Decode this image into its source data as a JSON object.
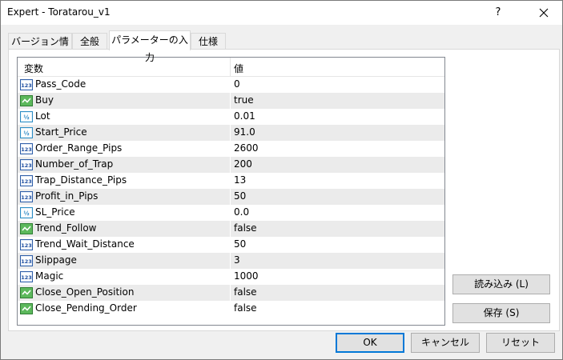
{
  "window": {
    "title": "Expert - Toratarou_v1",
    "help_label": "?"
  },
  "tabs": [
    {
      "label": "バージョン情報"
    },
    {
      "label": "全般"
    },
    {
      "label": "パラメーターの入力"
    },
    {
      "label": "仕様"
    }
  ],
  "grid": {
    "headers": {
      "variable": "変数",
      "value": "値"
    },
    "rows": [
      {
        "name": "Pass_Code",
        "value": "0",
        "icon": "int-icon"
      },
      {
        "name": "Buy",
        "value": "true",
        "icon": "bool-icon"
      },
      {
        "name": "Lot",
        "value": "0.01",
        "icon": "double-icon"
      },
      {
        "name": "Start_Price",
        "value": "91.0",
        "icon": "double-icon"
      },
      {
        "name": "Order_Range_Pips",
        "value": "2600",
        "icon": "int-icon"
      },
      {
        "name": "Number_of_Trap",
        "value": "200",
        "icon": "int-icon"
      },
      {
        "name": "Trap_Distance_Pips",
        "value": "13",
        "icon": "int-icon"
      },
      {
        "name": "Profit_in_Pips",
        "value": "50",
        "icon": "int-icon"
      },
      {
        "name": "SL_Price",
        "value": "0.0",
        "icon": "double-icon"
      },
      {
        "name": "Trend_Follow",
        "value": "false",
        "icon": "bool-icon"
      },
      {
        "name": "Trend_Wait_Distance",
        "value": "50",
        "icon": "int-icon"
      },
      {
        "name": "Slippage",
        "value": "3",
        "icon": "int-icon"
      },
      {
        "name": "Magic",
        "value": "1000",
        "icon": "int-icon"
      },
      {
        "name": "Close_Open_Position",
        "value": "false",
        "icon": "bool-icon"
      },
      {
        "name": "Close_Pending_Order",
        "value": "false",
        "icon": "bool-icon"
      }
    ]
  },
  "side_buttons": {
    "load": "読み込み (L)",
    "save": "保存 (S)"
  },
  "footer_buttons": {
    "ok": "OK",
    "cancel": "キャンセル",
    "reset": "リセット"
  },
  "colors": {
    "accent": "#0078d7",
    "row_alt": "#ebebeb"
  }
}
